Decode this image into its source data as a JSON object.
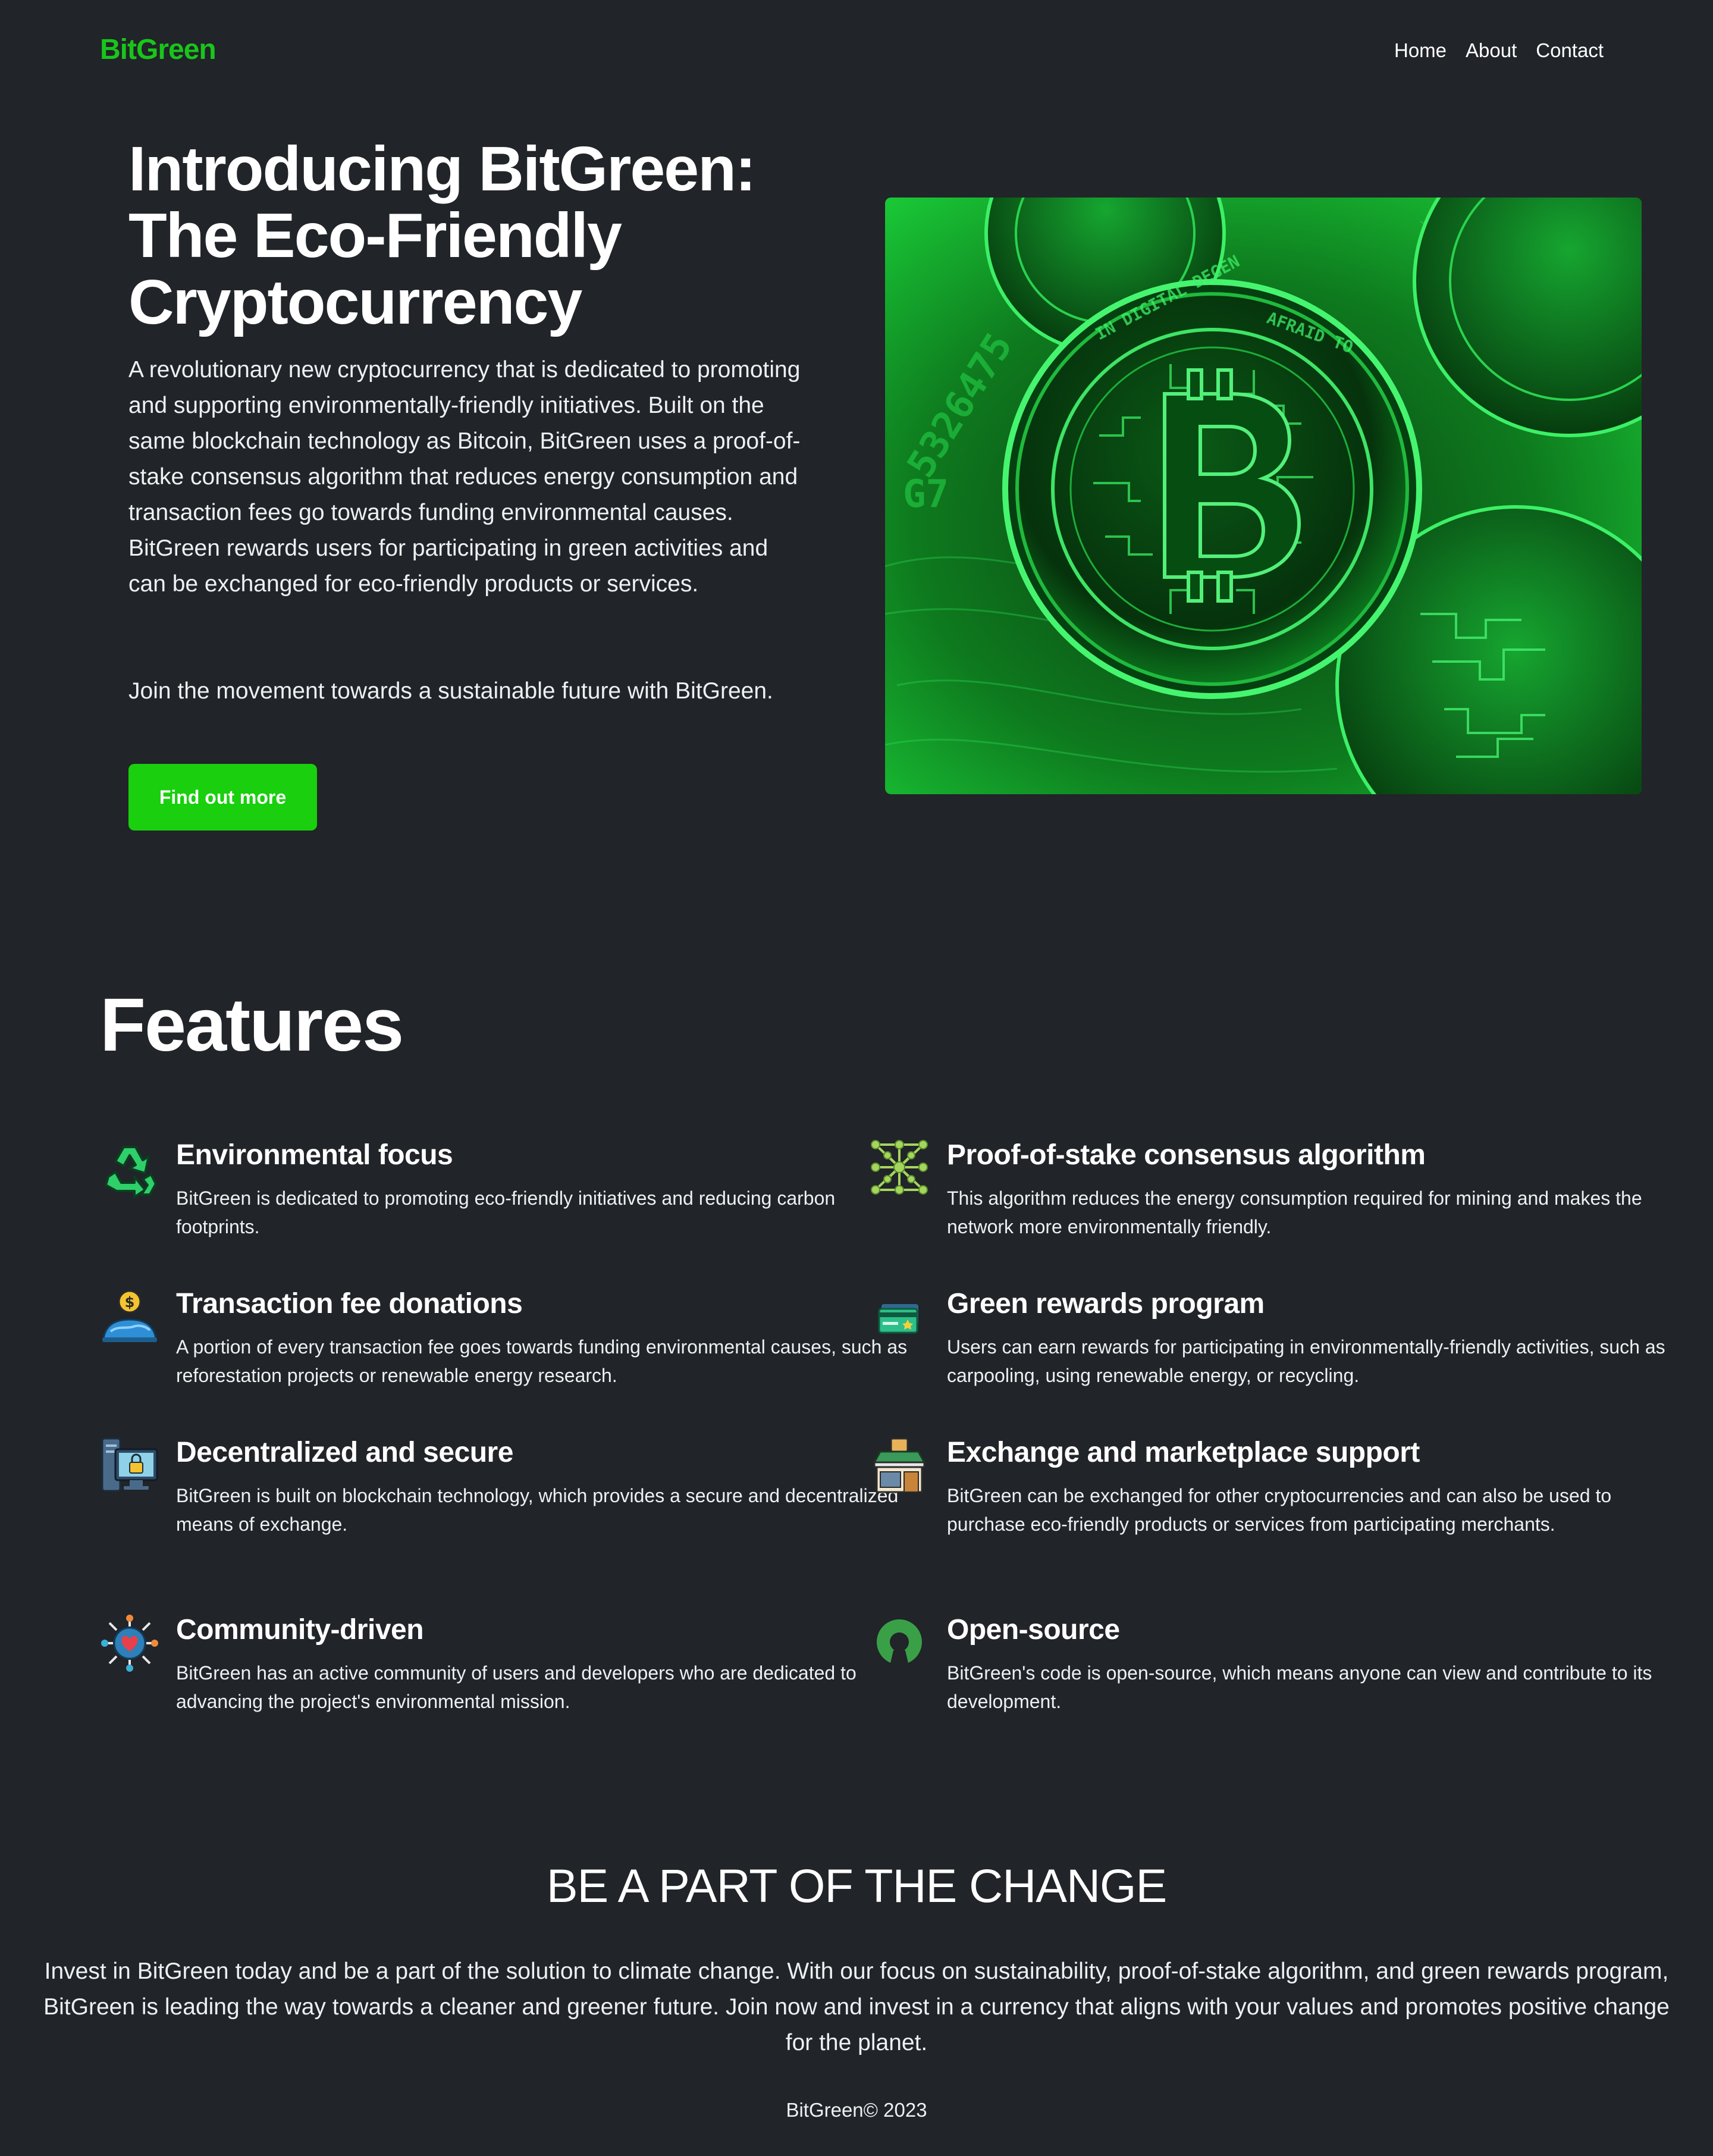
{
  "brand": {
    "name": "BitGreen",
    "color": "#19c51b"
  },
  "nav": {
    "links": [
      "Home",
      "About",
      "Contact"
    ]
  },
  "hero": {
    "title_lines": [
      "Introducing BitGreen:",
      "The Eco-Friendly",
      "Cryptocurrency"
    ],
    "description": "A revolutionary new cryptocurrency that is dedicated to promoting and supporting environmentally-friendly initiatives. Built on the same blockchain technology as Bitcoin, BitGreen uses a proof-of-stake consensus algorithm that reduces energy consumption and transaction fees go towards funding environmental causes. BitGreen rewards users for participating in green activities and can be exchanged for eco-friendly products or services.",
    "join_text": "Join the movement towards a sustainable future with BitGreen.",
    "cta_label": "Find out more",
    "cta_color": "#19cf0e",
    "image_icon": "green-bitcoin-coins-image"
  },
  "features": {
    "title": "Features",
    "items": [
      {
        "icon": "recycle-icon",
        "title": "Environmental focus",
        "description": "BitGreen is dedicated to promoting eco-friendly initiatives and reducing carbon footprints."
      },
      {
        "icon": "network-nodes-icon",
        "title": "Proof-of-stake consensus algorithm",
        "description": "This algorithm reduces the energy consumption required for mining and makes the network more environmentally friendly."
      },
      {
        "icon": "coin-donation-icon",
        "title": "Transaction fee donations",
        "description": "A portion of every transaction fee goes towards funding environmental causes, such as reforestation projects or renewable energy research."
      },
      {
        "icon": "reward-card-icon",
        "title": "Green rewards program",
        "description": "Users can earn rewards for participating in environmentally-friendly activities, such as carpooling, using renewable energy, or recycling."
      },
      {
        "icon": "secure-computer-icon",
        "title": "Decentralized and secure",
        "description": "BitGreen is built on blockchain technology, which provides a secure and decentralized means of exchange."
      },
      {
        "icon": "marketplace-store-icon",
        "title": "Exchange and marketplace support",
        "description": "BitGreen can be exchanged for other cryptocurrencies and can also be used to purchase eco-friendly products or services from participating merchants."
      },
      {
        "icon": "community-heart-icon",
        "title": "Community-driven",
        "description": "BitGreen has an active community of users and developers who are dedicated to advancing the project's environmental mission."
      },
      {
        "icon": "open-source-icon",
        "title": "Open-source",
        "description": "BitGreen's code is open-source, which means anyone can view and contribute to its development."
      }
    ]
  },
  "change": {
    "title": "BE A PART OF THE CHANGE",
    "description": "Invest in BitGreen today and be a part of the solution to climate change. With our focus on sustainability, proof-of-stake algorithm, and green rewards program, BitGreen is leading the way towards a cleaner and greener future. Join now and invest in a currency that aligns with your values and promotes positive change for the planet."
  },
  "footer": {
    "text": "BitGreen© 2023"
  }
}
